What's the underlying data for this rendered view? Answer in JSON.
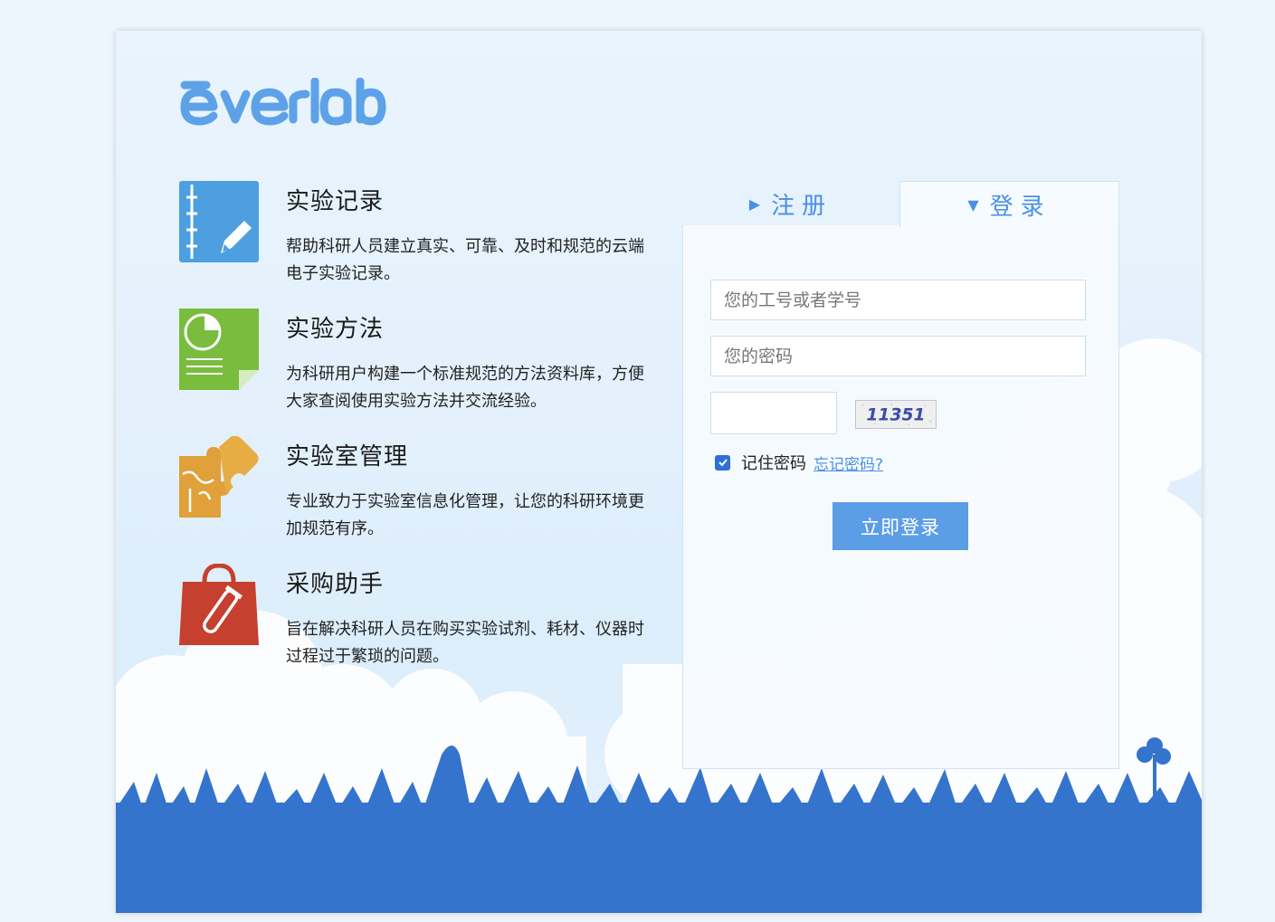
{
  "logo": {
    "text": "everlab"
  },
  "features": [
    {
      "title": "实验记录",
      "desc": "帮助科研人员建立真实、可靠、及时和规范的云端电子实验记录。",
      "icon": "notebook-pen-icon"
    },
    {
      "title": "实验方法",
      "desc": "为科研用户构建一个标准规范的方法资料库，方便大家查阅使用实验方法并交流经验。",
      "icon": "pie-chart-document-icon"
    },
    {
      "title": "实验室管理",
      "desc": "专业致力于实验室信息化管理，让您的科研环境更加规范有序。",
      "icon": "puzzle-icon"
    },
    {
      "title": "采购助手",
      "desc": "旨在解决科研人员在购买实验试剂、耗材、仪器时过程过于繁琐的问题。",
      "icon": "shopping-bag-test-tube-icon"
    }
  ],
  "tabs": {
    "register": "注册",
    "login": "登录"
  },
  "form": {
    "username_placeholder": "您的工号或者学号",
    "password_placeholder": "您的密码",
    "captcha_code": "11351",
    "remember_label": "记住密码",
    "remember_checked": true,
    "forgot_label": "忘记密码?",
    "submit_label": "立即登录"
  },
  "colors": {
    "accent": "#4a90e2",
    "button": "#5b9ee6",
    "ground": "#3574cc"
  }
}
